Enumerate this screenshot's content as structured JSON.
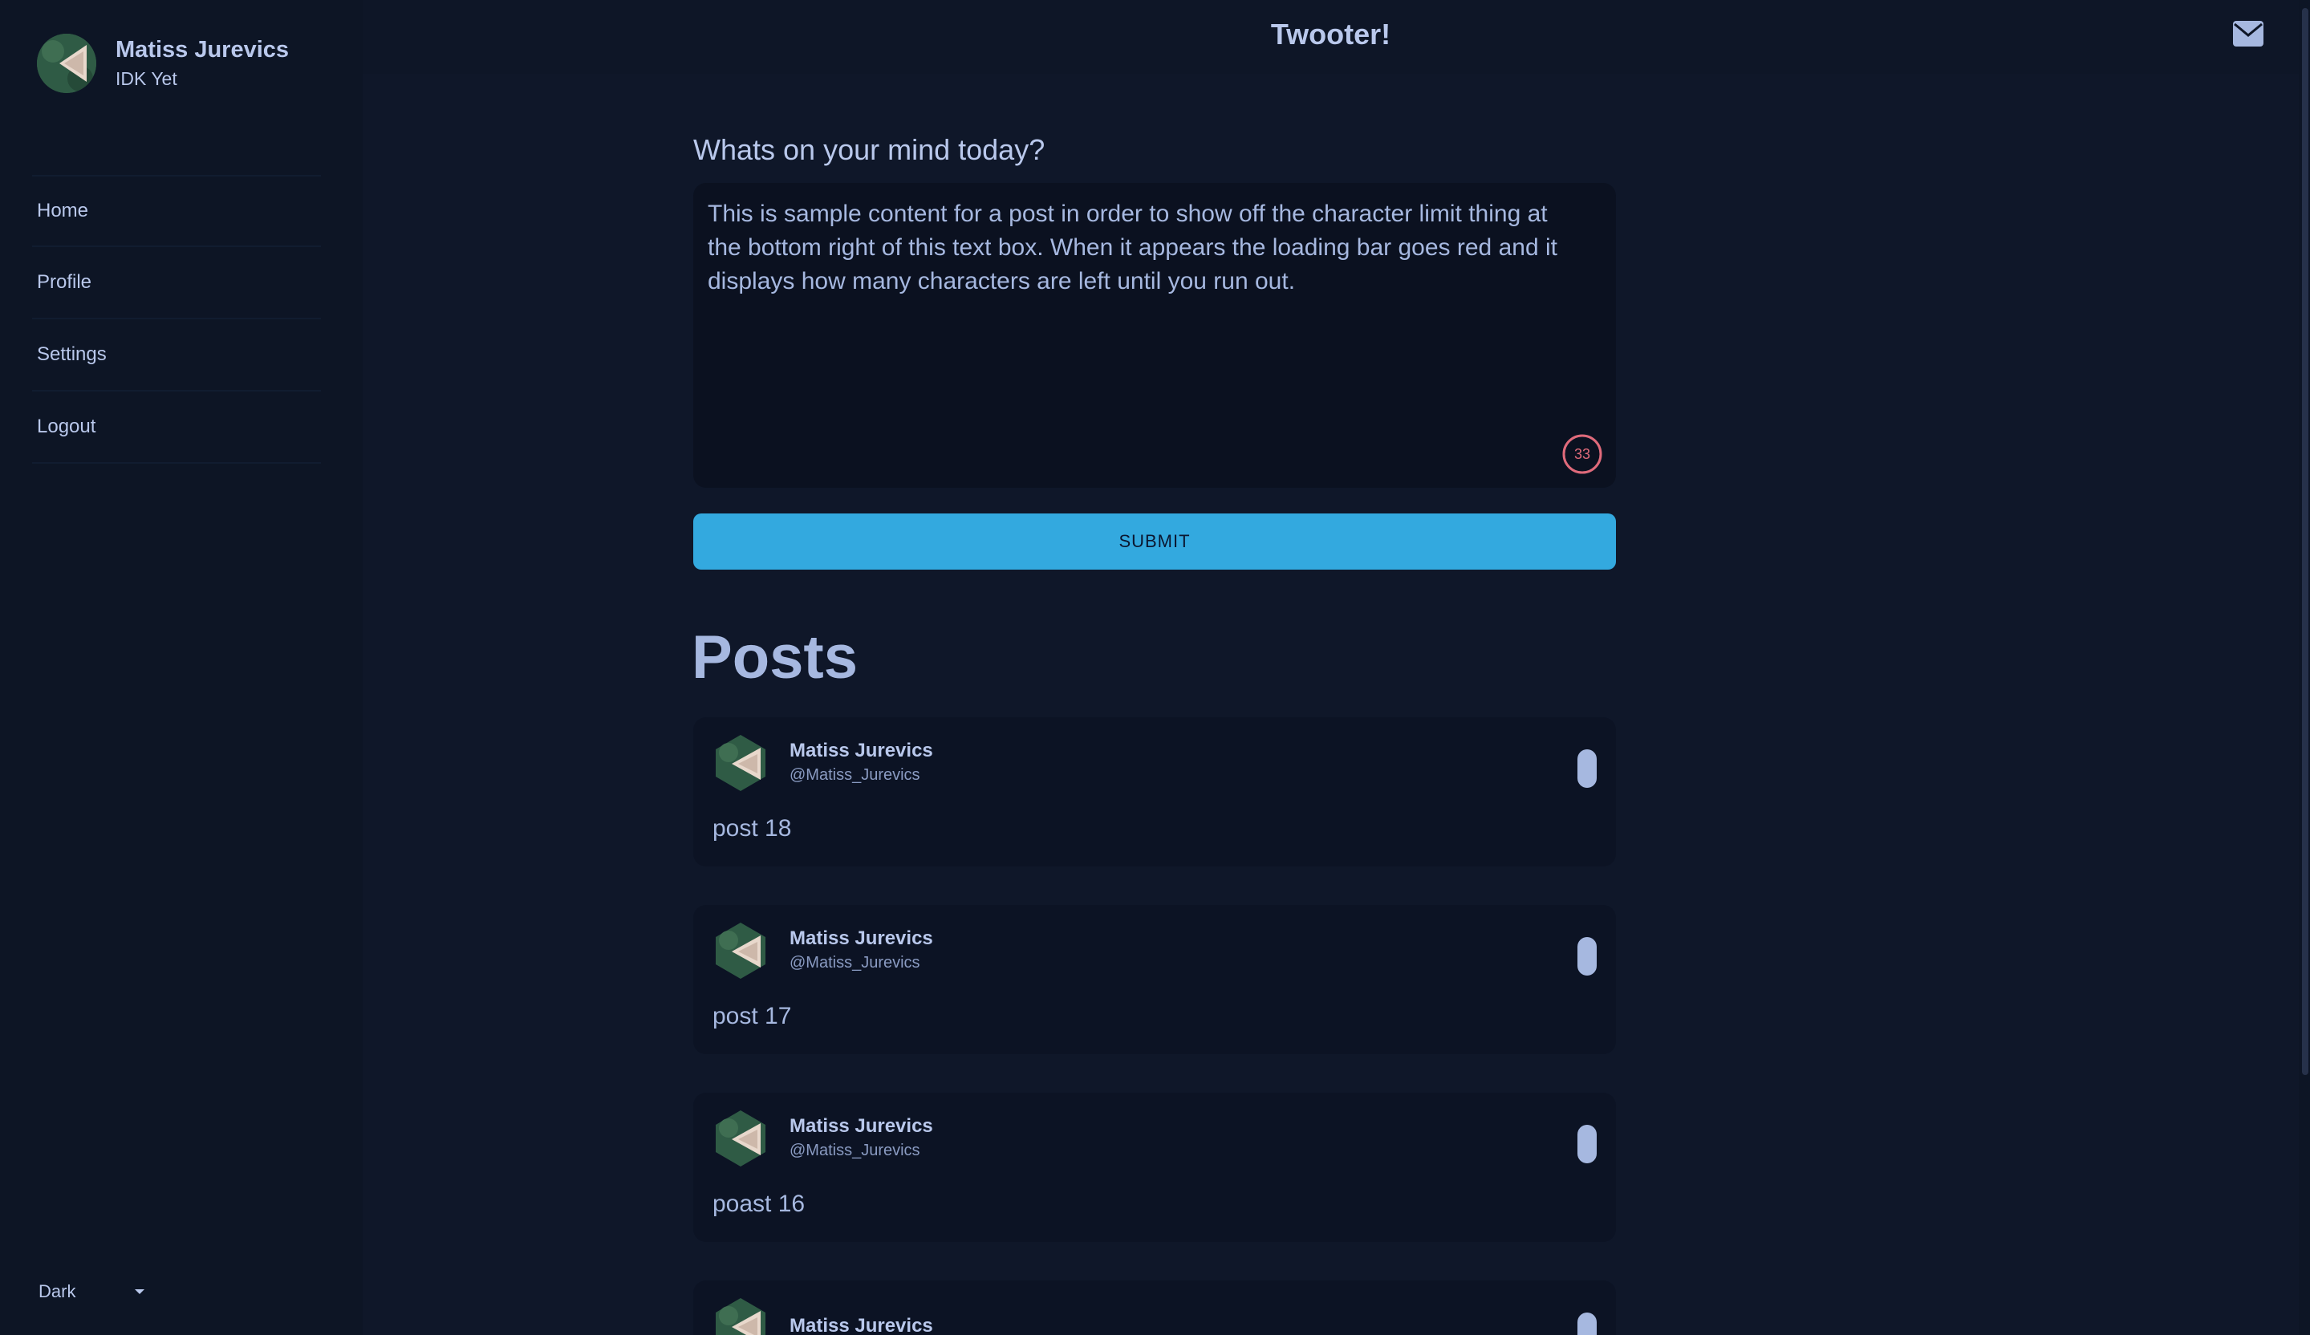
{
  "app": {
    "title": "Twooter!"
  },
  "user": {
    "name": "Matiss Jurevics",
    "subtitle": "IDK Yet"
  },
  "sidebar": {
    "items": [
      {
        "label": "Home"
      },
      {
        "label": "Profile"
      },
      {
        "label": "Settings"
      },
      {
        "label": "Logout"
      }
    ]
  },
  "theme": {
    "selected": "Dark"
  },
  "composer": {
    "label": "Whats on your mind today?",
    "value": "This is sample content for a post in order to show off the character limit thing at the bottom right of this text box. When it appears the loading bar goes red and it displays how many characters are left until you run out.",
    "remaining": "33",
    "submit_label": "SUBMIT"
  },
  "posts_heading": "Posts",
  "posts": [
    {
      "name": "Matiss Jurevics",
      "handle": "@Matiss_Jurevics",
      "body": "post 18"
    },
    {
      "name": "Matiss Jurevics",
      "handle": "@Matiss_Jurevics",
      "body": "post 17"
    },
    {
      "name": "Matiss Jurevics",
      "handle": "@Matiss_Jurevics",
      "body": "poast 16"
    },
    {
      "name": "Matiss Jurevics",
      "handle": "",
      "body": ""
    }
  ],
  "colors": {
    "background": "#0f1729",
    "accent": "#33a9df",
    "counter_warning": "#e06a7a"
  },
  "icons": {
    "mail": "mail-icon",
    "theme_caret": "caret-down-icon"
  }
}
